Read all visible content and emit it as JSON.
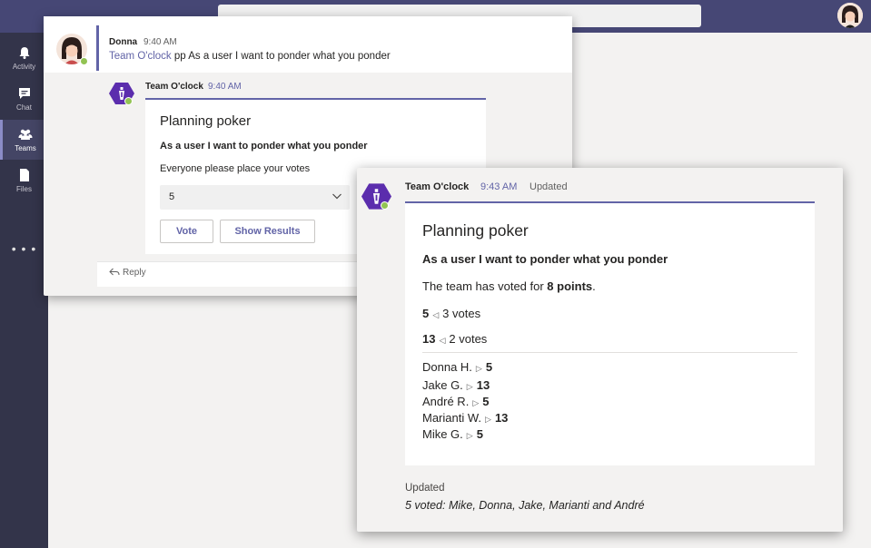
{
  "app": {
    "rail": {
      "items": [
        {
          "label": "Activity",
          "icon": "bell-icon"
        },
        {
          "label": "Chat",
          "icon": "chat-icon"
        },
        {
          "label": "Teams",
          "icon": "teams-icon"
        },
        {
          "label": "Files",
          "icon": "file-icon"
        }
      ],
      "more": "• • •"
    }
  },
  "message1": {
    "author": "Donna",
    "time": "9:40 AM",
    "mention": "Team O'clock",
    "text": " pp As a user I want to ponder what you ponder"
  },
  "bot_reply1": {
    "author": "Team O'clock",
    "time": "9:40 AM",
    "card": {
      "title": "Planning poker",
      "subtitle": "As a user I want to ponder what you ponder",
      "prompt": "Everyone please place your votes",
      "select_value": "5",
      "vote_button": "Vote",
      "results_button": "Show Results"
    },
    "reply_label": "Reply"
  },
  "bot_reply2": {
    "author": "Team O'clock",
    "time": "9:43 AM",
    "status": "Updated",
    "card": {
      "title": "Planning poker",
      "subtitle": "As a user I want to ponder what you ponder",
      "result_prefix": "The team has voted for ",
      "result_points": "8 points",
      "result_suffix": ".",
      "tallies": [
        {
          "value": "5",
          "votes": "3 votes"
        },
        {
          "value": "13",
          "votes": "2 votes"
        }
      ],
      "voters": [
        {
          "name": "Donna H.",
          "vote": "5"
        },
        {
          "name": "Jake G.",
          "vote": "13"
        },
        {
          "name": "André R.",
          "vote": "5"
        },
        {
          "name": "Marianti W.",
          "vote": "13"
        },
        {
          "name": "Mike G.",
          "vote": "5"
        }
      ]
    },
    "footer_updated": "Updated",
    "footer_voted": "5 voted: Mike, Donna, Jake, Marianti and André"
  },
  "colors": {
    "accent": "#6264a7",
    "rail": "#33344a",
    "topbar": "#464775",
    "presence": "#92c353",
    "bot": "#5b2dad"
  }
}
